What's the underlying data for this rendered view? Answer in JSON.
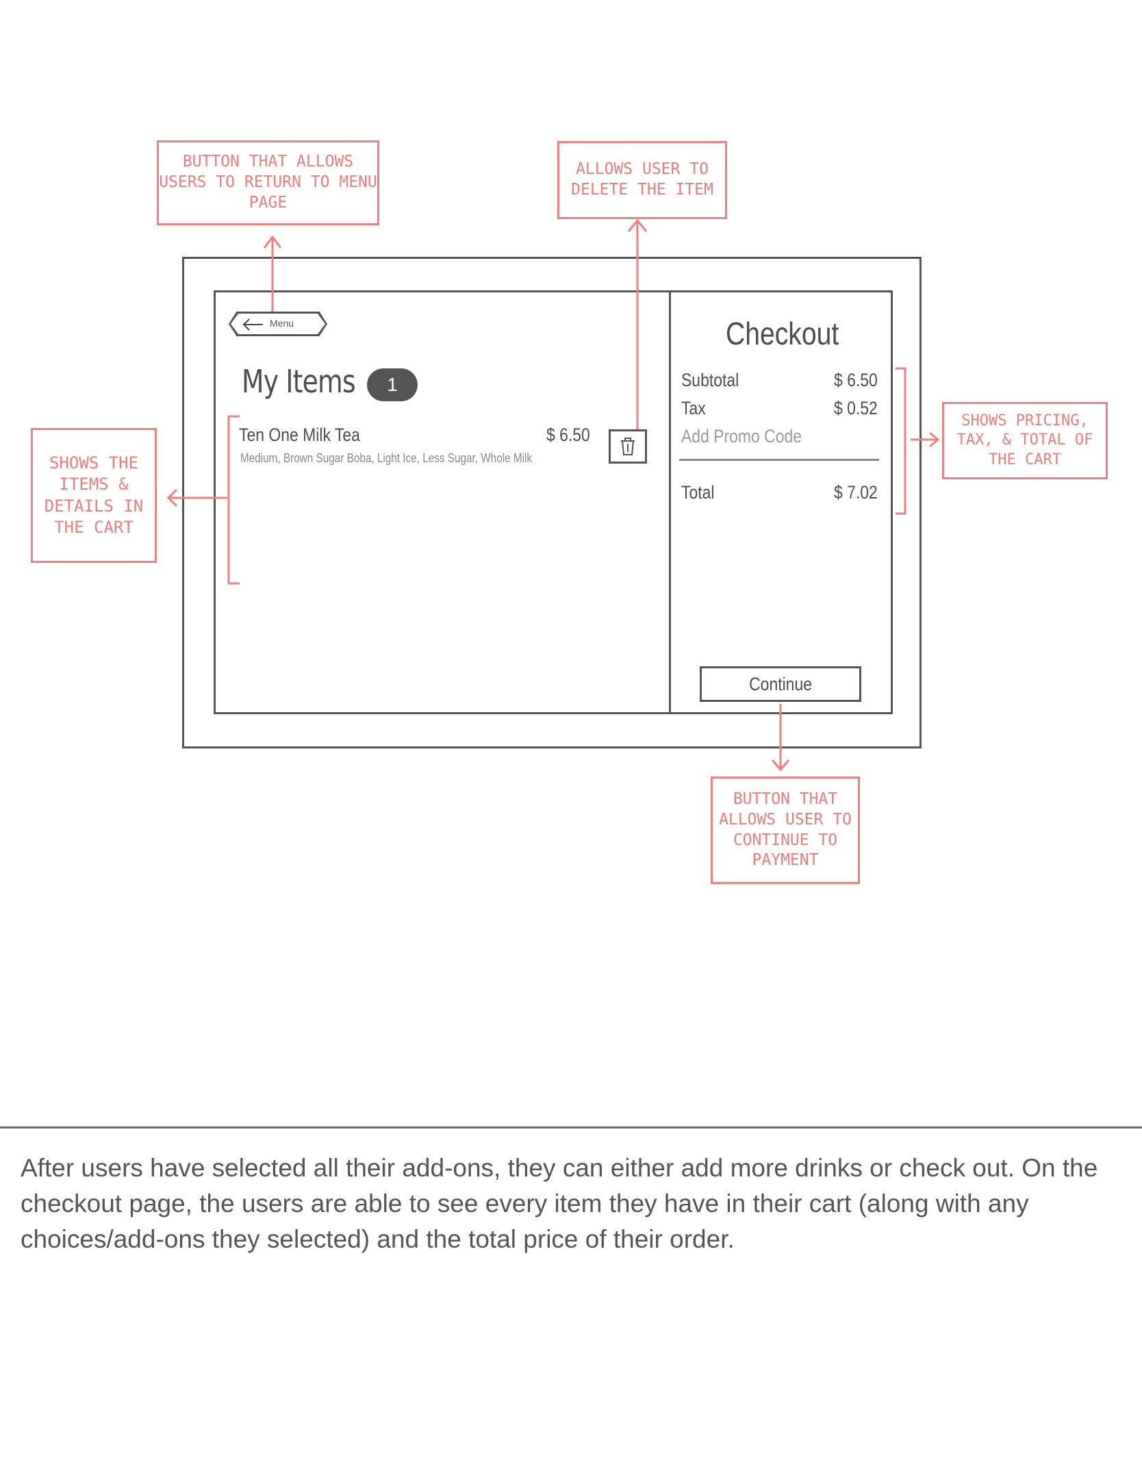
{
  "wireframe": {
    "menu_button": {
      "label": "Menu",
      "icon": "arrow-left-icon"
    },
    "my_items": {
      "title": "My Items",
      "count": "1"
    },
    "item": {
      "name": "Ten One Milk Tea",
      "details": "Medium, Brown Sugar Boba, Light Ice, Less Sugar, Whole Milk",
      "price": "$ 6.50",
      "delete_icon": "trash-icon"
    },
    "checkout": {
      "title": "Checkout",
      "subtotal_label": "Subtotal",
      "subtotal_value": "$ 6.50",
      "tax_label": "Tax",
      "tax_value": "$ 0.52",
      "promo_placeholder": "Add Promo Code",
      "total_label": "Total",
      "total_value": "$ 7.02",
      "continue_label": "Continue"
    }
  },
  "annotations": {
    "menu_button_note": "Button that allows users to return to menu page",
    "delete_note": "Allows user to delete the item",
    "items_note": "Shows the items & details in the cart",
    "pricing_note": "Shows pricing, tax, & total of the cart",
    "continue_note": "Button that allows user to continue to payment"
  },
  "caption": "After users have selected all their add-ons, they can either add more drinks or check out. On the checkout page, the users are able to see every item they have in their cart (along with any choices/add-ons they selected) and the total price of their order.",
  "colors": {
    "annotation": "#f08080",
    "wireframe_stroke": "#555555",
    "badge_fill": "#555555"
  }
}
